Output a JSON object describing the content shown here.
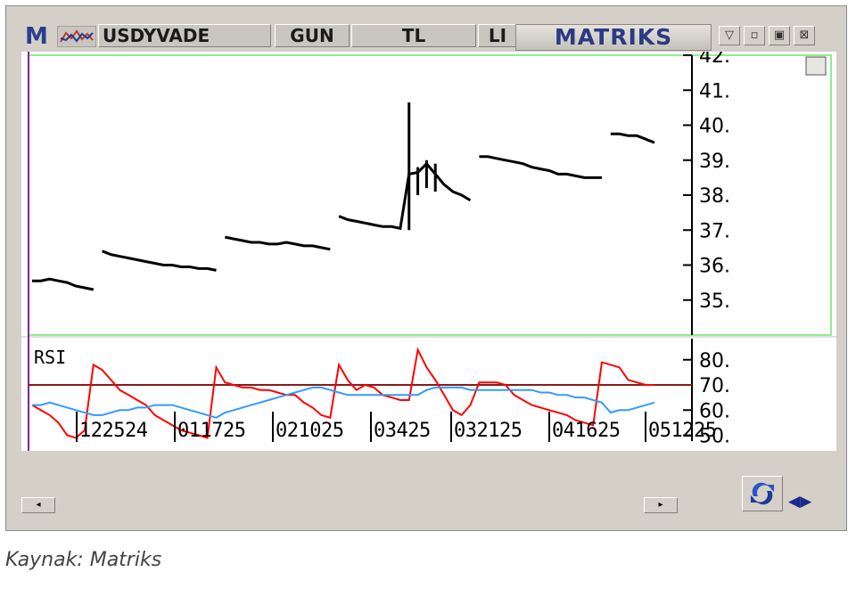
{
  "toolbar": {
    "brand_letter": "M",
    "symbol": "USDYVADE",
    "period": "GUN",
    "currency": "TL",
    "partial_tab": "LI",
    "vendor": "MATRIKS",
    "icons": [
      "chart-type-icon",
      "dropdown-icon",
      "minimize-icon",
      "restore-icon",
      "close-icon"
    ]
  },
  "caption": "Kaynak: Matriks",
  "colors": {
    "price": "#000000",
    "rsi": "#ff0000",
    "rsi_signal": "#3399ff",
    "level_line": "#8b1a1a",
    "panel_border": "#90ee90"
  },
  "chart_data": [
    {
      "type": "line",
      "panel": "price",
      "ylim": [
        34,
        42
      ],
      "y_ticks": [
        "35.",
        "36.",
        "37.",
        "38.",
        "39.",
        "40.",
        "41.",
        "42."
      ],
      "x": [
        0,
        1,
        2,
        3,
        4,
        5,
        6,
        7,
        8,
        9,
        10,
        11,
        12,
        13,
        14,
        15,
        16,
        17,
        18,
        19,
        20,
        21,
        22,
        23,
        24,
        25,
        26,
        27,
        28,
        29,
        30,
        31,
        32,
        33,
        34,
        35,
        36,
        37,
        38,
        39,
        40,
        41,
        42,
        43,
        44,
        45,
        46,
        47,
        48,
        49,
        50,
        51,
        52,
        53,
        54,
        55,
        56,
        57,
        58,
        59,
        60,
        61,
        62,
        63,
        64,
        65,
        66,
        67,
        68,
        69,
        70,
        71
      ],
      "close": [
        35.55,
        35.55,
        35.6,
        35.55,
        35.5,
        35.4,
        35.35,
        35.3,
        36.4,
        36.3,
        36.25,
        36.2,
        36.15,
        36.1,
        36.05,
        36.0,
        36.0,
        35.95,
        35.95,
        35.9,
        35.9,
        35.85,
        36.8,
        36.75,
        36.7,
        36.65,
        36.65,
        36.6,
        36.6,
        36.65,
        36.6,
        36.55,
        36.55,
        36.5,
        36.45,
        37.4,
        37.3,
        37.25,
        37.2,
        37.15,
        37.1,
        37.1,
        37.05,
        38.6,
        38.65,
        38.9,
        38.6,
        38.3,
        38.1,
        38.0,
        37.85,
        39.1,
        39.1,
        39.05,
        39.0,
        38.95,
        38.9,
        38.8,
        38.75,
        38.7,
        38.6,
        38.6,
        38.55,
        38.5,
        38.5,
        38.5,
        39.75,
        39.75,
        39.7,
        39.7,
        39.6,
        39.5
      ],
      "high": [
        null,
        null,
        null,
        null,
        null,
        null,
        null,
        null,
        null,
        null,
        null,
        null,
        null,
        null,
        null,
        null,
        null,
        null,
        null,
        null,
        null,
        null,
        null,
        null,
        null,
        null,
        null,
        null,
        null,
        null,
        null,
        null,
        null,
        null,
        null,
        null,
        null,
        null,
        null,
        null,
        null,
        null,
        null,
        40.65,
        38.8,
        39.0,
        38.9,
        null,
        null,
        null,
        null,
        null,
        null,
        null,
        null,
        null,
        null,
        null,
        null,
        null,
        null,
        null,
        null,
        null,
        null,
        null,
        null,
        null,
        null,
        null,
        null,
        null
      ],
      "low": [
        null,
        null,
        null,
        null,
        null,
        null,
        null,
        null,
        null,
        null,
        null,
        null,
        null,
        null,
        null,
        null,
        null,
        null,
        null,
        null,
        null,
        null,
        null,
        null,
        null,
        null,
        null,
        null,
        null,
        null,
        null,
        null,
        null,
        null,
        null,
        null,
        null,
        null,
        null,
        null,
        null,
        null,
        null,
        37.0,
        38.0,
        38.2,
        38.1,
        null,
        null,
        null,
        null,
        null,
        null,
        null,
        null,
        null,
        null,
        null,
        null,
        null,
        null,
        null,
        null,
        null,
        null,
        null,
        null,
        null,
        null,
        null,
        null,
        null
      ],
      "x_tick_labels": [
        "122524",
        "011725",
        "021025",
        "03425",
        "032125",
        "041625",
        "051225"
      ]
    },
    {
      "type": "line",
      "panel": "rsi",
      "title": "RSI",
      "ylim": [
        47,
        87
      ],
      "y_ticks": [
        "50.",
        "60.",
        "70.",
        "80."
      ],
      "reference_level": 70,
      "x": [
        0,
        1,
        2,
        3,
        4,
        5,
        6,
        7,
        8,
        9,
        10,
        11,
        12,
        13,
        14,
        15,
        16,
        17,
        18,
        19,
        20,
        21,
        22,
        23,
        24,
        25,
        26,
        27,
        28,
        29,
        30,
        31,
        32,
        33,
        34,
        35,
        36,
        37,
        38,
        39,
        40,
        41,
        42,
        43,
        44,
        45,
        46,
        47,
        48,
        49,
        50,
        51,
        52,
        53,
        54,
        55,
        56,
        57,
        58,
        59,
        60,
        61,
        62,
        63,
        64,
        65,
        66,
        67,
        68,
        69,
        70,
        71
      ],
      "series": [
        {
          "values": [
            62,
            60,
            58,
            55,
            50,
            49,
            52,
            78,
            76,
            72,
            68,
            66,
            64,
            62,
            58,
            56,
            54,
            52,
            51,
            50,
            49,
            77,
            71,
            70,
            69,
            69,
            68,
            68,
            67,
            66,
            66,
            63,
            61,
            58,
            57,
            78,
            72,
            68,
            70,
            69,
            66,
            65,
            64,
            64,
            84,
            77,
            72,
            66,
            60,
            58,
            62,
            71,
            71,
            71,
            70,
            66,
            64,
            62,
            61,
            60,
            59,
            58,
            56,
            55,
            54,
            79,
            78,
            77,
            72,
            71,
            70,
            70
          ]
        },
        {
          "values": [
            62,
            62,
            63,
            62,
            61,
            60,
            59,
            58,
            58,
            59,
            60,
            60,
            61,
            61,
            62,
            62,
            62,
            61,
            60,
            59,
            58,
            57,
            59,
            60,
            61,
            62,
            63,
            64,
            65,
            66,
            67,
            68,
            69,
            69,
            68,
            67,
            66,
            66,
            66,
            66,
            66,
            66,
            66,
            66,
            66,
            68,
            69,
            69,
            69,
            69,
            68,
            68,
            68,
            68,
            68,
            68,
            68,
            68,
            67,
            67,
            66,
            66,
            65,
            65,
            64,
            63,
            59,
            60,
            60,
            61,
            62,
            63
          ]
        }
      ]
    }
  ]
}
